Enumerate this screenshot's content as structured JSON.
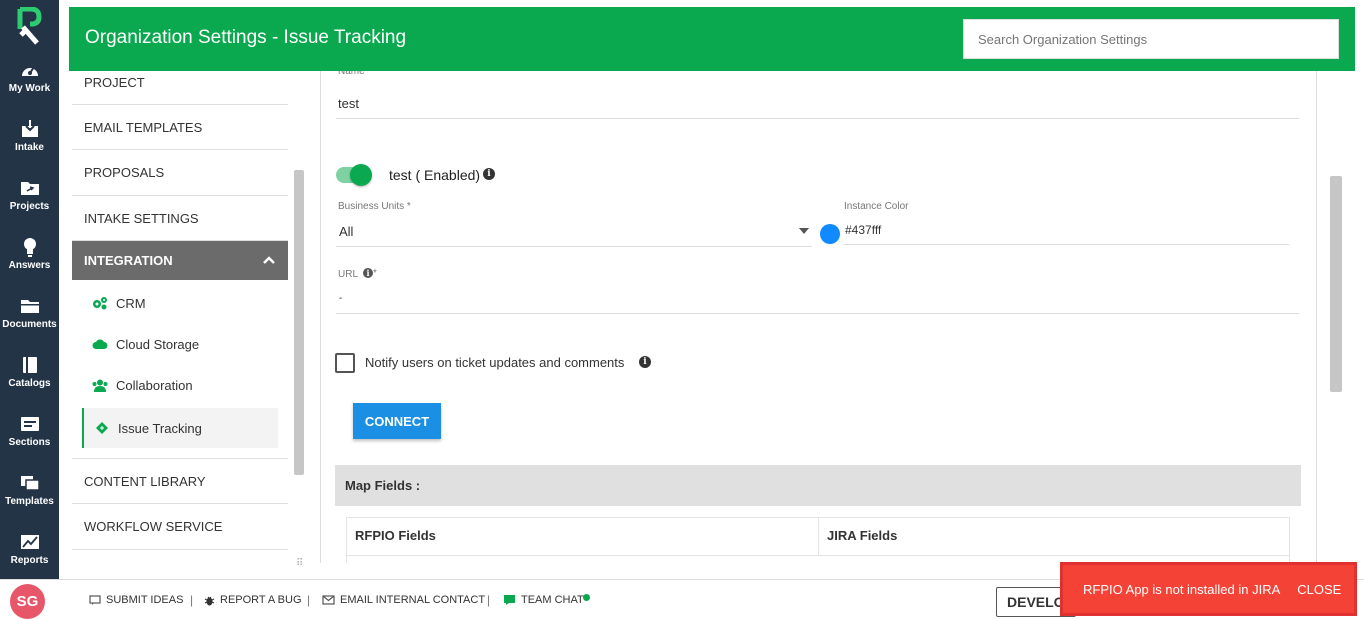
{
  "rail": {
    "items": [
      {
        "label": "My Work",
        "icon": "gauge-icon"
      },
      {
        "label": "Intake",
        "icon": "inbox-download-icon"
      },
      {
        "label": "Projects",
        "icon": "folder-share-icon"
      },
      {
        "label": "Answers",
        "icon": "lightbulb-icon"
      },
      {
        "label": "Documents",
        "icon": "folder-icon"
      },
      {
        "label": "Catalogs",
        "icon": "book-icon"
      },
      {
        "label": "Sections",
        "icon": "section-card-icon"
      },
      {
        "label": "Templates",
        "icon": "copy-icon"
      },
      {
        "label": "Reports",
        "icon": "chart-image-icon"
      }
    ]
  },
  "header": {
    "title": "Organization Settings - Issue Tracking",
    "search_placeholder": "Search Organization Settings",
    "color": "#0aa84f"
  },
  "sidebar": {
    "items_top": [
      "PROJECT",
      "EMAIL TEMPLATES",
      "PROPOSALS",
      "INTAKE SETTINGS"
    ],
    "active": "INTEGRATION",
    "sub_items": [
      {
        "label": "CRM",
        "icon": "gears-icon"
      },
      {
        "label": "Cloud Storage",
        "icon": "cloud-icon"
      },
      {
        "label": "Collaboration",
        "icon": "users-icon"
      },
      {
        "label": "Issue Tracking",
        "icon": "ticket-icon"
      }
    ],
    "items_bottom": [
      "CONTENT LIBRARY",
      "WORKFLOW SERVICE"
    ]
  },
  "form": {
    "name_label": "Name",
    "name_value": "test",
    "toggle_label": "test ( Enabled)",
    "toggle_on": true,
    "business_units_label": "Business Units *",
    "business_units_value": "All",
    "instance_color_label": "Instance Color",
    "instance_color_value": "#437fff",
    "url_label": "URL",
    "url_required": "*",
    "url_value": "-",
    "notify_label": "Notify users on ticket updates and comments",
    "notify_checked": false,
    "connect_label": "CONNECT"
  },
  "map_fields": {
    "title": "Map Fields :",
    "columns": [
      "RFPIO Fields",
      "JIRA Fields"
    ]
  },
  "footer": {
    "avatar_initials": "SG",
    "links": [
      "SUBMIT IDEAS",
      "REPORT A BUG",
      "EMAIL INTERNAL CONTACT",
      "TEAM CHAT"
    ],
    "env_button": "DEVELOPMENT"
  },
  "toast": {
    "message": "RFPIO App is not installed in JIRA",
    "close_label": "CLOSE"
  }
}
